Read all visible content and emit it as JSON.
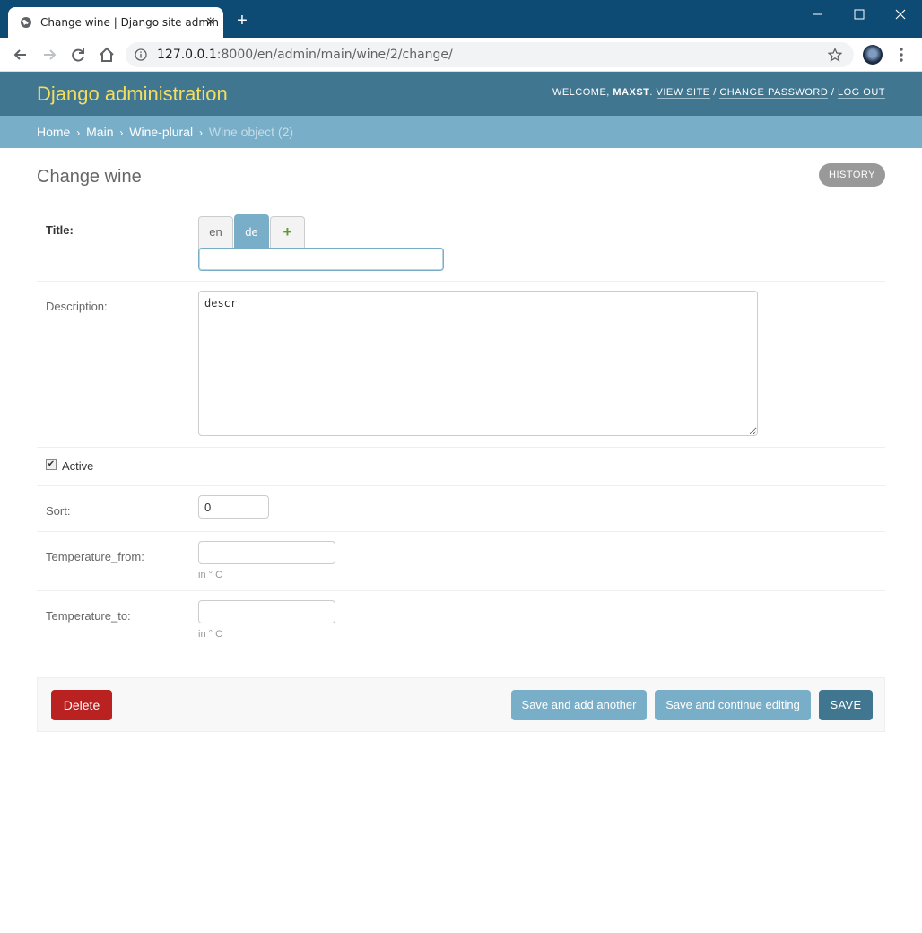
{
  "browser": {
    "tab_title": "Change wine | Django site admin",
    "tab_close": "✕",
    "new_tab": "+",
    "url_host": "127.0.0.1",
    "url_rest": ":8000/en/admin/main/wine/2/change/"
  },
  "header": {
    "brand": "Django administration",
    "welcome": "Welcome, ",
    "username": "maxst",
    "view_site": "View site",
    "change_password": "Change password",
    "log_out": "Log out",
    "sep": " / "
  },
  "breadcrumbs": {
    "home": "Home",
    "main": "Main",
    "model": "Wine-plural",
    "current": "Wine object (2)",
    "sep": "›"
  },
  "page": {
    "title": "Change wine",
    "history": "History"
  },
  "form": {
    "title_label": "Title:",
    "lang_tabs": [
      "en",
      "de",
      "+"
    ],
    "active_lang": "de",
    "title_value": "",
    "description_label": "Description:",
    "description_value": "descr",
    "active_label": "Active",
    "active_checked": true,
    "sort_label": "Sort:",
    "sort_value": "0",
    "temp_from_label": "Temperature_from:",
    "temp_from_value": "",
    "temp_from_help": "in ° C",
    "temp_to_label": "Temperature_to:",
    "temp_to_value": "",
    "temp_to_help": "in ° C"
  },
  "actions": {
    "delete": "Delete",
    "save_add": "Save and add another",
    "save_continue": "Save and continue editing",
    "save": "SAVE"
  },
  "colors": {
    "header_bg": "#417690",
    "breadcrumb_bg": "#79aec8",
    "brand_yellow": "#f5dd5d",
    "delete_red": "#ba2121"
  }
}
